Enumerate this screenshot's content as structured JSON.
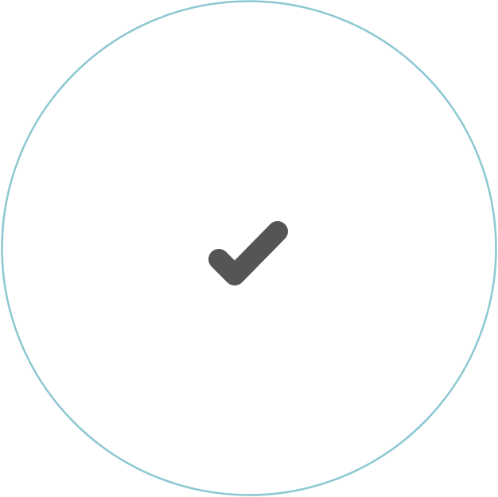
{
  "status_indicator": {
    "icon": "checkmark-icon",
    "state": "complete",
    "colors": {
      "ring": "#8cc8d0",
      "check": "#555555",
      "background": "#ffffff"
    }
  }
}
